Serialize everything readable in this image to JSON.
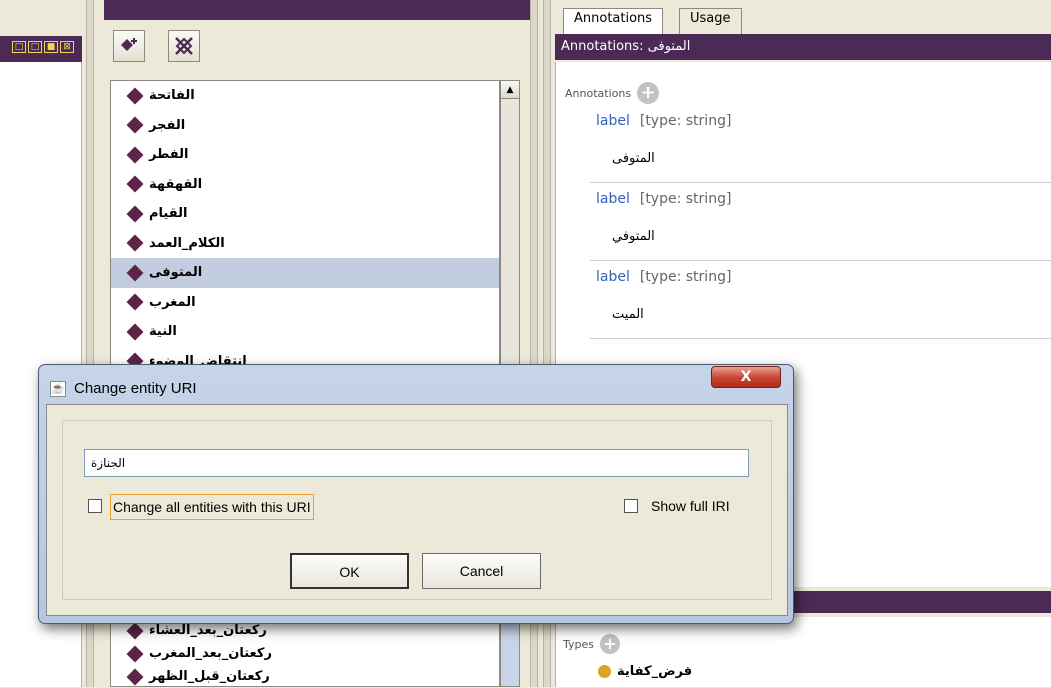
{
  "view_buttons": [
    "□",
    "□",
    "■",
    "⊠"
  ],
  "toolbar": {
    "add_icon": "add-individual-icon",
    "delete_icon": "delete-individual-icon"
  },
  "entity_list": {
    "items": [
      {
        "label": "الفاتحة",
        "selected": false
      },
      {
        "label": "الفجر",
        "selected": false
      },
      {
        "label": "الفطر",
        "selected": false
      },
      {
        "label": "القهقهة",
        "selected": false
      },
      {
        "label": "القيام",
        "selected": false
      },
      {
        "label": "الكلام_العمد",
        "selected": false
      },
      {
        "label": "المتوفى",
        "selected": true
      },
      {
        "label": "المغرب",
        "selected": false
      },
      {
        "label": "النية",
        "selected": false
      },
      {
        "label": "انتقاض_الوضوء",
        "selected": false
      }
    ],
    "bottom_items": [
      {
        "label": "ركعتان_بعد_العشاء"
      },
      {
        "label": "ركعتان_بعد_المغرب"
      },
      {
        "label": "ركعتان_قبل_الظهر"
      }
    ]
  },
  "right_panel": {
    "tabs": [
      "Annotations",
      "Usage"
    ],
    "header": "Annotations: المتوفى",
    "annotations_title": "Annotations",
    "annotations": [
      {
        "property": "label",
        "type": "[type: string]",
        "value": "المتوفى"
      },
      {
        "property": "label",
        "type": "[type: string]",
        "value": "المتوفي"
      },
      {
        "property": "label",
        "type": "[type: string]",
        "value": "الميت"
      }
    ],
    "types_title": "Types",
    "type_item": "فرض_كفاية"
  },
  "dialog": {
    "title": "Change entity URI",
    "close_label": "X",
    "uri_value": "الجنازة",
    "change_all_label": "Change all entities with this URI",
    "change_all_checked": false,
    "show_full_iri_label": "Show full IRI",
    "show_full_iri_checked": false,
    "ok_label": "OK",
    "cancel_label": "Cancel"
  }
}
